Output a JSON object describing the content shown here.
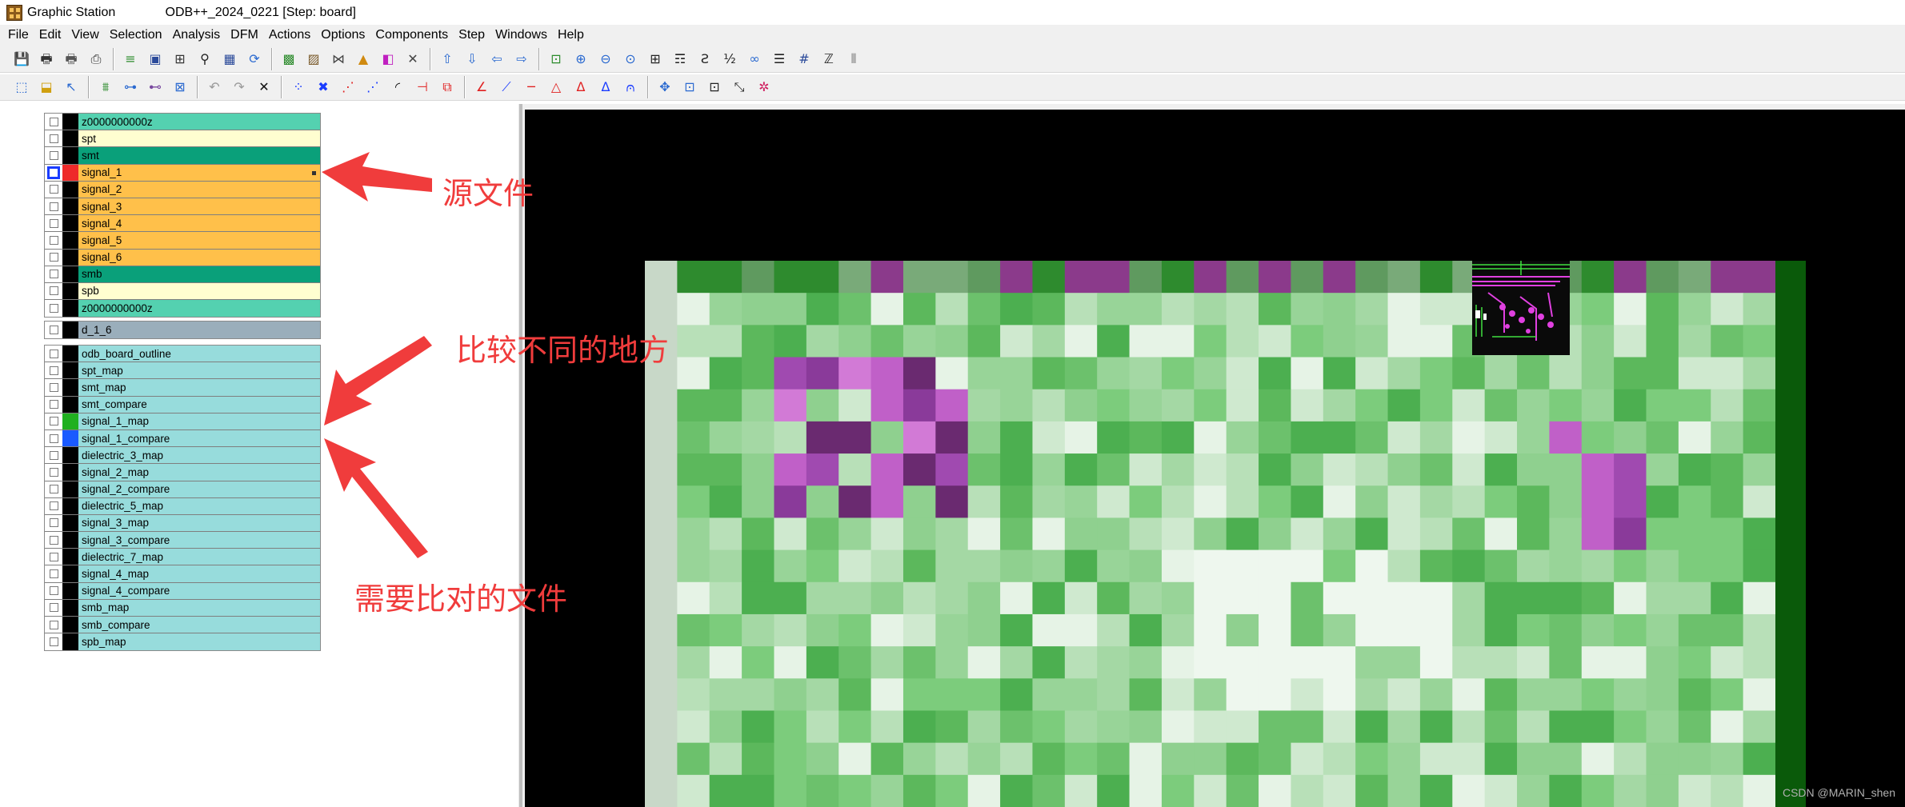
{
  "window": {
    "title": "Graphic Station              ODB++_2024_0221 [Step: board]"
  },
  "menu": [
    "File",
    "Edit",
    "View",
    "Selection",
    "Analysis",
    "DFM",
    "Actions",
    "Options",
    "Components",
    "Step",
    "Windows",
    "Help"
  ],
  "toolbar1": [
    {
      "icon": "save-icon",
      "glyph": "💾",
      "color": "#2b4a9a"
    },
    {
      "icon": "print-icon",
      "glyph": "🖶",
      "color": "#333333"
    },
    {
      "icon": "print-preview-icon",
      "glyph": "🖶",
      "color": "#555555"
    },
    {
      "icon": "pdf-icon",
      "glyph": "⎙",
      "color": "#333333"
    },
    {
      "sep": true
    },
    {
      "icon": "layers-icon",
      "glyph": "≡",
      "color": "#2a8a2a"
    },
    {
      "icon": "page-icon",
      "glyph": "▣",
      "color": "#2b4a9a"
    },
    {
      "icon": "measure-icon",
      "glyph": "⊞",
      "color": "#333333"
    },
    {
      "icon": "binoculars-icon",
      "glyph": "⚲",
      "color": "#222222"
    },
    {
      "icon": "grid-table-icon",
      "glyph": "▦",
      "color": "#2b4a9a"
    },
    {
      "icon": "refresh-icon",
      "glyph": "⟳",
      "color": "#2b6ad0"
    },
    {
      "sep": true
    },
    {
      "icon": "image-icon",
      "glyph": "▩",
      "color": "#2a8a2a"
    },
    {
      "icon": "image-edit-icon",
      "glyph": "▨",
      "color": "#7a5a2a"
    },
    {
      "icon": "compare-icon",
      "glyph": "⋈",
      "color": "#444444"
    },
    {
      "icon": "triangle-tool-icon",
      "glyph": "▲",
      "color": "#d08a10"
    },
    {
      "icon": "palette-icon",
      "glyph": "◧",
      "color": "#c020c0"
    },
    {
      "icon": "tools-icon",
      "glyph": "✕",
      "color": "#444444"
    },
    {
      "sep": true
    },
    {
      "icon": "arrow-up-icon",
      "glyph": "⇧",
      "color": "#2b6ad0"
    },
    {
      "icon": "arrow-down-icon",
      "glyph": "⇩",
      "color": "#2b6ad0"
    },
    {
      "icon": "arrow-left-icon",
      "glyph": "⇦",
      "color": "#2b6ad0"
    },
    {
      "icon": "arrow-right-icon",
      "glyph": "⇨",
      "color": "#2b6ad0"
    },
    {
      "sep": true
    },
    {
      "icon": "zoom-fit-icon",
      "glyph": "⊡",
      "color": "#2a8a2a"
    },
    {
      "icon": "zoom-in-icon",
      "glyph": "⊕",
      "color": "#2b6ad0"
    },
    {
      "icon": "zoom-out-icon",
      "glyph": "⊖",
      "color": "#2b6ad0"
    },
    {
      "icon": "zoom-area-icon",
      "glyph": "⊙",
      "color": "#2b6ad0"
    },
    {
      "icon": "window-split-icon",
      "glyph": "⊞",
      "color": "#222222"
    },
    {
      "icon": "layout-icon",
      "glyph": "☶",
      "color": "#222222"
    },
    {
      "icon": "step-s-icon",
      "glyph": "Ƨ",
      "color": "#222222"
    },
    {
      "icon": "ratio-icon",
      "glyph": "½",
      "color": "#222222"
    },
    {
      "icon": "glasses-icon",
      "glyph": "∞",
      "color": "#2b6ad0"
    },
    {
      "icon": "stack-icon",
      "glyph": "☰",
      "color": "#222222"
    },
    {
      "icon": "hash-grid-icon",
      "glyph": "#",
      "color": "#2b4a9a"
    },
    {
      "icon": "z-icon",
      "glyph": "ℤ",
      "color": "#222222"
    },
    {
      "icon": "chart-icon",
      "glyph": "⫴",
      "color": "#777777"
    }
  ],
  "toolbar2": [
    {
      "icon": "select-icon",
      "glyph": "⬚",
      "color": "#2b6ad0"
    },
    {
      "icon": "select-window-icon",
      "glyph": "⬓",
      "color": "#d0a010"
    },
    {
      "icon": "pointer-icon",
      "glyph": "↖",
      "color": "#2b6ad0"
    },
    {
      "sep": true
    },
    {
      "icon": "filter-icon",
      "glyph": "⩩",
      "color": "#2a8a2a"
    },
    {
      "icon": "net-icon",
      "glyph": "⊶",
      "color": "#2b6ad0"
    },
    {
      "icon": "component-icon",
      "glyph": "⊷",
      "color": "#7a4aa0"
    },
    {
      "icon": "board-icon",
      "glyph": "⊠",
      "color": "#2b6ad0"
    },
    {
      "sep": true
    },
    {
      "icon": "undo-icon",
      "glyph": "↶",
      "color": "#999999"
    },
    {
      "icon": "redo-icon",
      "glyph": "↷",
      "color": "#999999"
    },
    {
      "icon": "close-icon",
      "glyph": "✕",
      "color": "#111111"
    },
    {
      "sep": true
    },
    {
      "icon": "snap-points-icon",
      "glyph": "⁘",
      "color": "#1a3cff"
    },
    {
      "icon": "snap-intersect-icon",
      "glyph": "✖",
      "color": "#1a3cff"
    },
    {
      "icon": "snap-mid-icon",
      "glyph": "⋰",
      "color": "#e02020"
    },
    {
      "icon": "snap-end-icon",
      "glyph": "⋰",
      "color": "#1a3cff"
    },
    {
      "icon": "arc-icon",
      "glyph": "◜",
      "color": "#111111"
    },
    {
      "icon": "edge-icon",
      "glyph": "⊣",
      "color": "#e02020"
    },
    {
      "icon": "square-snap-icon",
      "glyph": "⧉",
      "color": "#e02020"
    },
    {
      "sep": true
    },
    {
      "icon": "angle-icon",
      "glyph": "∠",
      "color": "#e02020"
    },
    {
      "icon": "diagonal-icon",
      "glyph": "⟋",
      "color": "#1a3cff"
    },
    {
      "icon": "line-icon",
      "glyph": "─",
      "color": "#e02020"
    },
    {
      "icon": "triangle-measure-icon",
      "glyph": "△",
      "color": "#e02020"
    },
    {
      "icon": "triangle-a-icon",
      "glyph": "Δ",
      "color": "#e02020"
    },
    {
      "icon": "triangle-b-icon",
      "glyph": "Δ",
      "color": "#1a3cff"
    },
    {
      "icon": "arch-icon",
      "glyph": "⩀",
      "color": "#1a3cff"
    },
    {
      "sep": true
    },
    {
      "icon": "move-icon",
      "glyph": "✥",
      "color": "#2b6ad0"
    },
    {
      "icon": "box-select-icon",
      "glyph": "⊡",
      "color": "#2b6ad0"
    },
    {
      "icon": "box-center-icon",
      "glyph": "⊡",
      "color": "#222222"
    },
    {
      "icon": "resize-icon",
      "glyph": "⤡",
      "color": "#222222"
    },
    {
      "icon": "star-icon",
      "glyph": "✲",
      "color": "#d02060"
    }
  ],
  "layers_top": [
    {
      "name": "z0000000000z",
      "bg": "#54d1b0",
      "color": "#000000",
      "checked": false
    },
    {
      "name": "spt",
      "bg": "#fffed0",
      "color": "#000000",
      "checked": false
    },
    {
      "name": "smt",
      "bg": "#0aa07a",
      "color": "#000000",
      "checked": false
    },
    {
      "name": "signal_1",
      "bg": "#ffc04a",
      "color": "#ee2a2a",
      "checked": true,
      "marker": true
    },
    {
      "name": "signal_2",
      "bg": "#ffc04a",
      "color": "#000000",
      "checked": false
    },
    {
      "name": "signal_3",
      "bg": "#ffc04a",
      "color": "#000000",
      "checked": false
    },
    {
      "name": "signal_4",
      "bg": "#ffc04a",
      "color": "#000000",
      "checked": false
    },
    {
      "name": "signal_5",
      "bg": "#ffc04a",
      "color": "#000000",
      "checked": false
    },
    {
      "name": "signal_6",
      "bg": "#ffc04a",
      "color": "#000000",
      "checked": false
    },
    {
      "name": "smb",
      "bg": "#0aa07a",
      "color": "#000000",
      "checked": false
    },
    {
      "name": "spb",
      "bg": "#fffed0",
      "color": "#000000",
      "checked": false
    },
    {
      "name": "z0000000000z",
      "bg": "#54d1b0",
      "color": "#000000",
      "checked": false
    }
  ],
  "layers_mid": [
    {
      "name": "d_1_6",
      "bg": "#9aaebb",
      "color": "#000000",
      "checked": false
    }
  ],
  "layers_bottom": [
    {
      "name": "odb_board_outline",
      "bg": "#97dcdc",
      "color": "#000000",
      "checked": false
    },
    {
      "name": "spt_map",
      "bg": "#97dcdc",
      "color": "#000000",
      "checked": false
    },
    {
      "name": "smt_map",
      "bg": "#97dcdc",
      "color": "#000000",
      "checked": false
    },
    {
      "name": "smt_compare",
      "bg": "#97dcdc",
      "color": "#000000",
      "checked": false
    },
    {
      "name": "signal_1_map",
      "bg": "#97dcdc",
      "color": "#20b020",
      "checked": false
    },
    {
      "name": "signal_1_compare",
      "bg": "#97dcdc",
      "color": "#1a5aff",
      "checked": false
    },
    {
      "name": "dielectric_3_map",
      "bg": "#97dcdc",
      "color": "#000000",
      "checked": false
    },
    {
      "name": "signal_2_map",
      "bg": "#97dcdc",
      "color": "#000000",
      "checked": false
    },
    {
      "name": "signal_2_compare",
      "bg": "#97dcdc",
      "color": "#000000",
      "checked": false
    },
    {
      "name": "dielectric_5_map",
      "bg": "#97dcdc",
      "color": "#000000",
      "checked": false
    },
    {
      "name": "signal_3_map",
      "bg": "#97dcdc",
      "color": "#000000",
      "checked": false
    },
    {
      "name": "signal_3_compare",
      "bg": "#97dcdc",
      "color": "#000000",
      "checked": false
    },
    {
      "name": "dielectric_7_map",
      "bg": "#97dcdc",
      "color": "#000000",
      "checked": false
    },
    {
      "name": "signal_4_map",
      "bg": "#97dcdc",
      "color": "#000000",
      "checked": false
    },
    {
      "name": "signal_4_compare",
      "bg": "#97dcdc",
      "color": "#000000",
      "checked": false
    },
    {
      "name": "smb_map",
      "bg": "#97dcdc",
      "color": "#000000",
      "checked": false
    },
    {
      "name": "smb_compare",
      "bg": "#97dcdc",
      "color": "#000000",
      "checked": false
    },
    {
      "name": "spb_map",
      "bg": "#97dcdc",
      "color": "#000000",
      "checked": false
    }
  ],
  "annotations": {
    "source_file": "源文件",
    "different_area": "比较不同的地方",
    "compare_files": "需要比对的文件",
    "color": "#f03c3c"
  },
  "watermark": "CSDN @MARIN_shen"
}
